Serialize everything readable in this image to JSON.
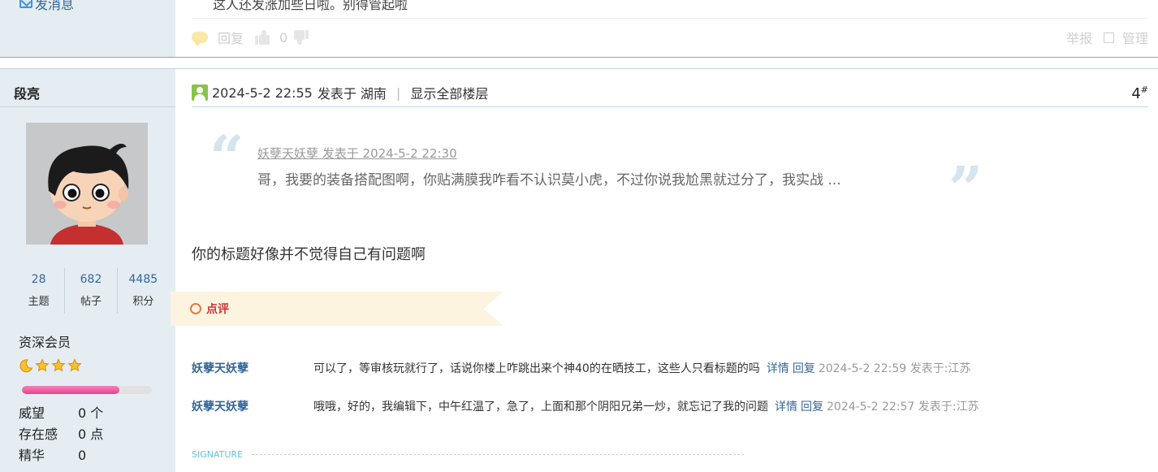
{
  "previous_post": {
    "send_message_label": "发消息",
    "text": "这人还发涨加些日啦。别得管起啦",
    "actions": {
      "reply_label": "回复",
      "like_count": "0",
      "report_label": "举报",
      "manage_label": "管理"
    }
  },
  "author": {
    "name": "段亮",
    "stats": [
      {
        "value": "28",
        "label": "主题"
      },
      {
        "value": "682",
        "label": "帖子"
      },
      {
        "value": "4485",
        "label": "积分"
      }
    ],
    "rank_title": "资深会员",
    "rank_stars": 4,
    "progress_fraction": 0.75,
    "attributes": [
      {
        "key": "威望",
        "value": "0 个"
      },
      {
        "key": "存在感",
        "value": "0 点"
      },
      {
        "key": "精华",
        "value": "0"
      }
    ]
  },
  "post": {
    "date": "2024-5-2 22:55",
    "posted_from": "发表于 湖南",
    "show_all_floors": "显示全部楼层",
    "floor_number": "4",
    "floor_suffix": "#",
    "quote": {
      "source": "妖孽天妖孽 发表于 2024-5-2 22:30",
      "text": "哥，我要的装备搭配图啊，你贴满膜我咋看不认识莫小虎，不过你说我尬黑就过分了，我实战 ..."
    },
    "body": "你的标题好像并不觉得自己有问题啊"
  },
  "comments_section": {
    "label": "点评",
    "items": [
      {
        "author": "妖孽天妖孽",
        "text": "可以了，等审核玩就行了，话说你楼上咋跳出来个神40的在晒技工，这些人只看标题的吗",
        "detail_label": "详情",
        "reply_label": "回复",
        "time": "2024-5-2 22:59 发表于:江苏"
      },
      {
        "author": "妖孽天妖孽",
        "text": "哦哦，好的，我编辑下，中午红温了，急了，上面和那个阴阳兄弟一炒，就忘记了我的问题",
        "detail_label": "详情",
        "reply_label": "回复",
        "time": "2024-5-2 22:57 发表于:江苏"
      }
    ]
  },
  "signature_label": "SIGNATURE",
  "colors": {
    "link": "#336699",
    "sidebar_bg": "#e5edf2",
    "ribbon_bg": "#fdf4e0",
    "comment_label": "#cc3333"
  }
}
